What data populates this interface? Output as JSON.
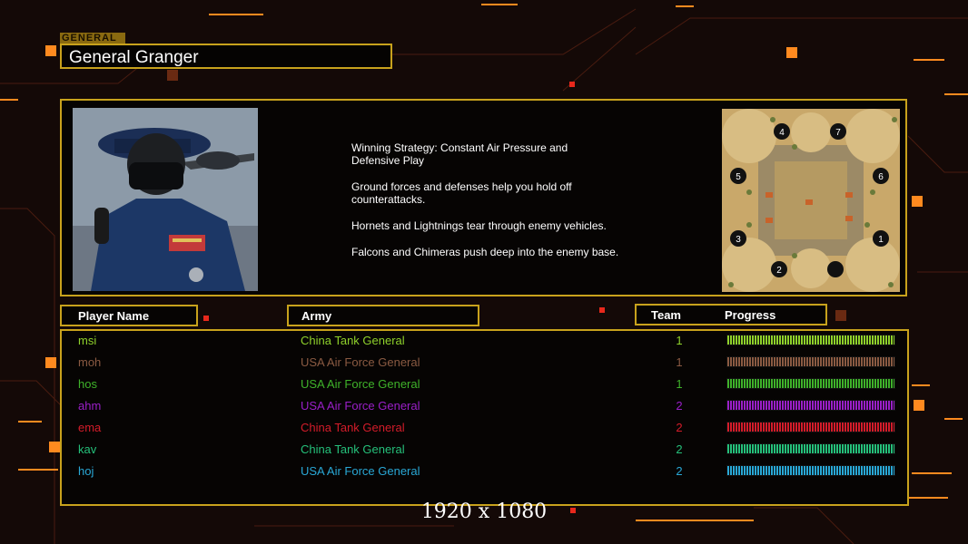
{
  "general": {
    "tag": "GENERAL",
    "name": "General Granger"
  },
  "strategy": [
    "Winning Strategy: Constant Air Pressure and\n Defensive Play",
    "Ground forces and defenses help you hold off\n counterattacks.",
    "Hornets and Lightnings tear through enemy vehicles.",
    "Falcons and Chimeras push deep into the enemy base."
  ],
  "map": {
    "start_positions": [
      "1",
      "2",
      "3",
      "4",
      "5",
      "6",
      "7"
    ]
  },
  "headers": {
    "player_name": "Player Name",
    "army": "Army",
    "team": "Team",
    "progress": "Progress"
  },
  "players": [
    {
      "name": "msi",
      "army": "China Tank General",
      "team": "1",
      "color": "#8fd12b",
      "progress": 1.0
    },
    {
      "name": "moh",
      "army": "USA Air Force General",
      "team": "1",
      "color": "#8a5a42",
      "progress": 1.0
    },
    {
      "name": "hos",
      "army": "USA Air Force General",
      "team": "1",
      "color": "#3fb22a",
      "progress": 1.0
    },
    {
      "name": "ahm",
      "army": "USA Air Force General",
      "team": "2",
      "color": "#9a1fc8",
      "progress": 1.0
    },
    {
      "name": "ema",
      "army": "China Tank General",
      "team": "2",
      "color": "#d41c2a",
      "progress": 1.0
    },
    {
      "name": "kav",
      "army": "China Tank General",
      "team": "2",
      "color": "#25c07a",
      "progress": 1.0
    },
    {
      "name": "hoj",
      "army": "USA Air Force General",
      "team": "2",
      "color": "#29a8d6",
      "progress": 1.0
    }
  ],
  "caption": "1920 x 1080",
  "colors": {
    "border_gold": "#c8a21c",
    "accent_orange": "#ff8a1f",
    "background": "#140907"
  }
}
